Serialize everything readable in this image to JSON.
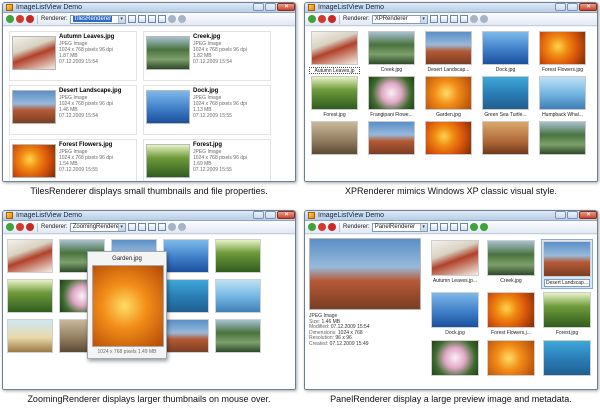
{
  "window_title": "ImageListView Demo",
  "renderer_label": "Renderer:",
  "panels": {
    "tiles": {
      "renderer_value": "TilesRenderer",
      "caption": "TilesRenderer displays small thumbnails and file properties.",
      "items": [
        {
          "name": "Autumn Leaves.jpg",
          "type": "JPEG Image",
          "dims": "1024 x 768 pixels 96 dpi",
          "size": "1.87 MB",
          "date": "07.12.2009 15:54",
          "img": "img-autumn"
        },
        {
          "name": "Creek.jpg",
          "type": "JPEG Image",
          "dims": "1024 x 768 pixels 96 dpi",
          "size": "1.82 MB",
          "date": "07.12.2009 15:54",
          "img": "img-creek"
        },
        {
          "name": "Desert Landscape.jpg",
          "type": "JPEG Image",
          "dims": "1024 x 768 pixels 96 dpi",
          "size": "1.46 MB",
          "date": "07.12.2009 15:54",
          "img": "img-desert"
        },
        {
          "name": "Dock.jpg",
          "type": "JPEG Image",
          "dims": "1024 x 768 pixels 96 dpi",
          "size": "1.13 MB",
          "date": "07.12.2009 15:55",
          "img": "img-dock"
        },
        {
          "name": "Forest Flowers.jpg",
          "type": "JPEG Image",
          "dims": "1024 x 768 pixels 96 dpi",
          "size": "1.54 MB",
          "date": "07.12.2009 15:55",
          "img": "img-flowers"
        },
        {
          "name": "Forest.jpg",
          "type": "JPEG Image",
          "dims": "1024 x 768 pixels 96 dpi",
          "size": "1.69 MB",
          "date": "07.12.2009 15:55",
          "img": "img-forest"
        }
      ]
    },
    "xp": {
      "renderer_value": "XPRenderer",
      "caption": "XPRenderer mimics Windows XP classic visual style.",
      "items": [
        {
          "label": "Autumn Leaves.jp",
          "img": "img-autumn",
          "focus": true
        },
        {
          "label": "Creek.jpg",
          "img": "img-creek"
        },
        {
          "label": "Desert Landscap...",
          "img": "img-desert"
        },
        {
          "label": "Dock.jpg",
          "img": "img-dock"
        },
        {
          "label": "Forest Flowers.jpg",
          "img": "img-flowers"
        },
        {
          "label": "Forest.jpg",
          "img": "img-forest"
        },
        {
          "label": "Frangipani Flowe...",
          "img": "img-frangipani"
        },
        {
          "label": "Garden.jpg",
          "img": "img-garden"
        },
        {
          "label": "Green Sea Turtle...",
          "img": "img-turtle"
        },
        {
          "label": "Humpback Whal...",
          "img": "img-whale"
        },
        {
          "label": "",
          "img": "img-wall"
        },
        {
          "label": "",
          "img": "img-desert"
        },
        {
          "label": "",
          "img": "img-flowers"
        },
        {
          "label": "",
          "img": "img-rocks"
        },
        {
          "label": "",
          "img": "img-creek"
        }
      ]
    },
    "zoom": {
      "renderer_value": "ZoomingRenderer",
      "caption": "ZoomingRenderer displays larger thumbnails on mouse over.",
      "items": [
        "img-autumn",
        "img-creek",
        "img-desert",
        "img-dock",
        "img-forest",
        "img-forest",
        "img-frangipani",
        "img-garden",
        "img-turtle",
        "img-whale",
        "img-tree",
        "img-wall",
        "img-rocks",
        "img-desert",
        "img-creek"
      ],
      "popup": {
        "title": "Garden.jpg",
        "info": "1024 x 768 pixels 1.49 MB",
        "img": "img-garden"
      }
    },
    "panel": {
      "renderer_value": "PanelRenderer",
      "caption": "PanelRenderer display a large preview image and metadata.",
      "preview_img": "img-desert",
      "meta": {
        "type": "JPEG Image",
        "size_k": "Size:",
        "size_v": "1.46 MB",
        "modified_k": "Modified:",
        "modified_v": "07.12.2009 15:54",
        "dimensions_k": "Dimensions:",
        "dimensions_v": "1024 x 768",
        "resolution_k": "Resolution:",
        "resolution_v": "96 x 96",
        "created_k": "Created:",
        "created_v": "07.12.2009 15:49"
      },
      "items": [
        {
          "label": "Autumn Leaves.jp...",
          "img": "img-autumn"
        },
        {
          "label": "Creek.jpg",
          "img": "img-creek"
        },
        {
          "label": "Desert Landscap...",
          "img": "img-desert",
          "selected": true
        },
        {
          "label": "Dock.jpg",
          "img": "img-dock"
        },
        {
          "label": "Forest Flowers.j...",
          "img": "img-flowers"
        },
        {
          "label": "Forest.jpg",
          "img": "img-forest"
        },
        {
          "label": "",
          "img": "img-frangipani"
        },
        {
          "label": "",
          "img": "img-garden"
        },
        {
          "label": "",
          "img": "img-turtle"
        }
      ]
    }
  }
}
